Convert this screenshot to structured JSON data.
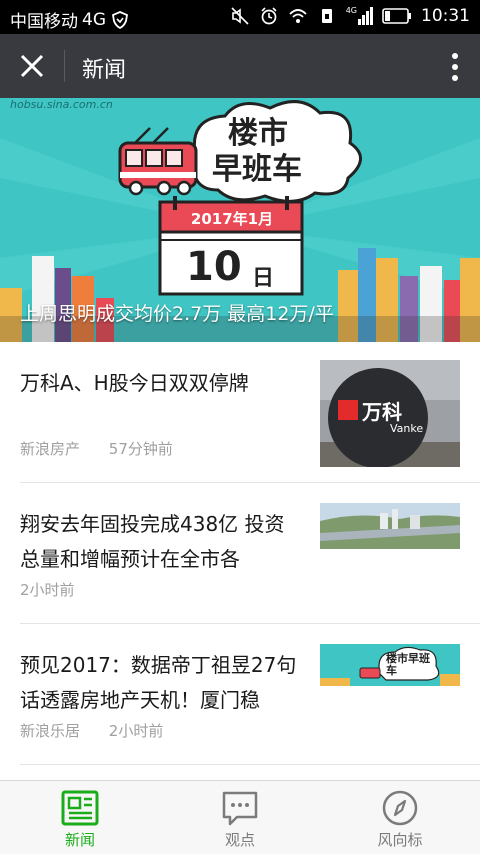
{
  "statusbar": {
    "carrier": "中国移动",
    "network": "4G",
    "time": "10:31",
    "mini_network": "4G"
  },
  "titlebar": {
    "title": "新闻"
  },
  "banner": {
    "watermark": "hobsu.sina.com.cn",
    "logo_line1": "楼市",
    "logo_line2": "早班车",
    "calendar_month": "2017年1月",
    "calendar_day": "10",
    "calendar_unit": "日",
    "caption": "上周思明成交均价2.7万 最高12万/平"
  },
  "articles": [
    {
      "title": "万科A、H股今日双双停牌",
      "source": "新浪房产",
      "time": "57分钟前",
      "thumb_text": "万科",
      "thumb_sub": "Vanke"
    },
    {
      "title": "翔安去年固投完成438亿 投资总量和增幅预计在全市各",
      "source": "",
      "time": "2小时前"
    },
    {
      "title": "预见2017：数据帝丁祖昱27句话透露房地产天机！厦门稳",
      "source": "新浪乐居",
      "time": "2小时前",
      "thumb_text": "楼市早班车"
    }
  ],
  "tabs": [
    {
      "label": "新闻",
      "icon": "newspaper-icon",
      "active": true
    },
    {
      "label": "观点",
      "icon": "chat-bubble-icon",
      "active": false
    },
    {
      "label": "风向标",
      "icon": "compass-icon",
      "active": false
    }
  ],
  "colors": {
    "accent": "#1aad19",
    "titlebar": "#393a3f",
    "banner_bg": "#3fc6c4"
  }
}
